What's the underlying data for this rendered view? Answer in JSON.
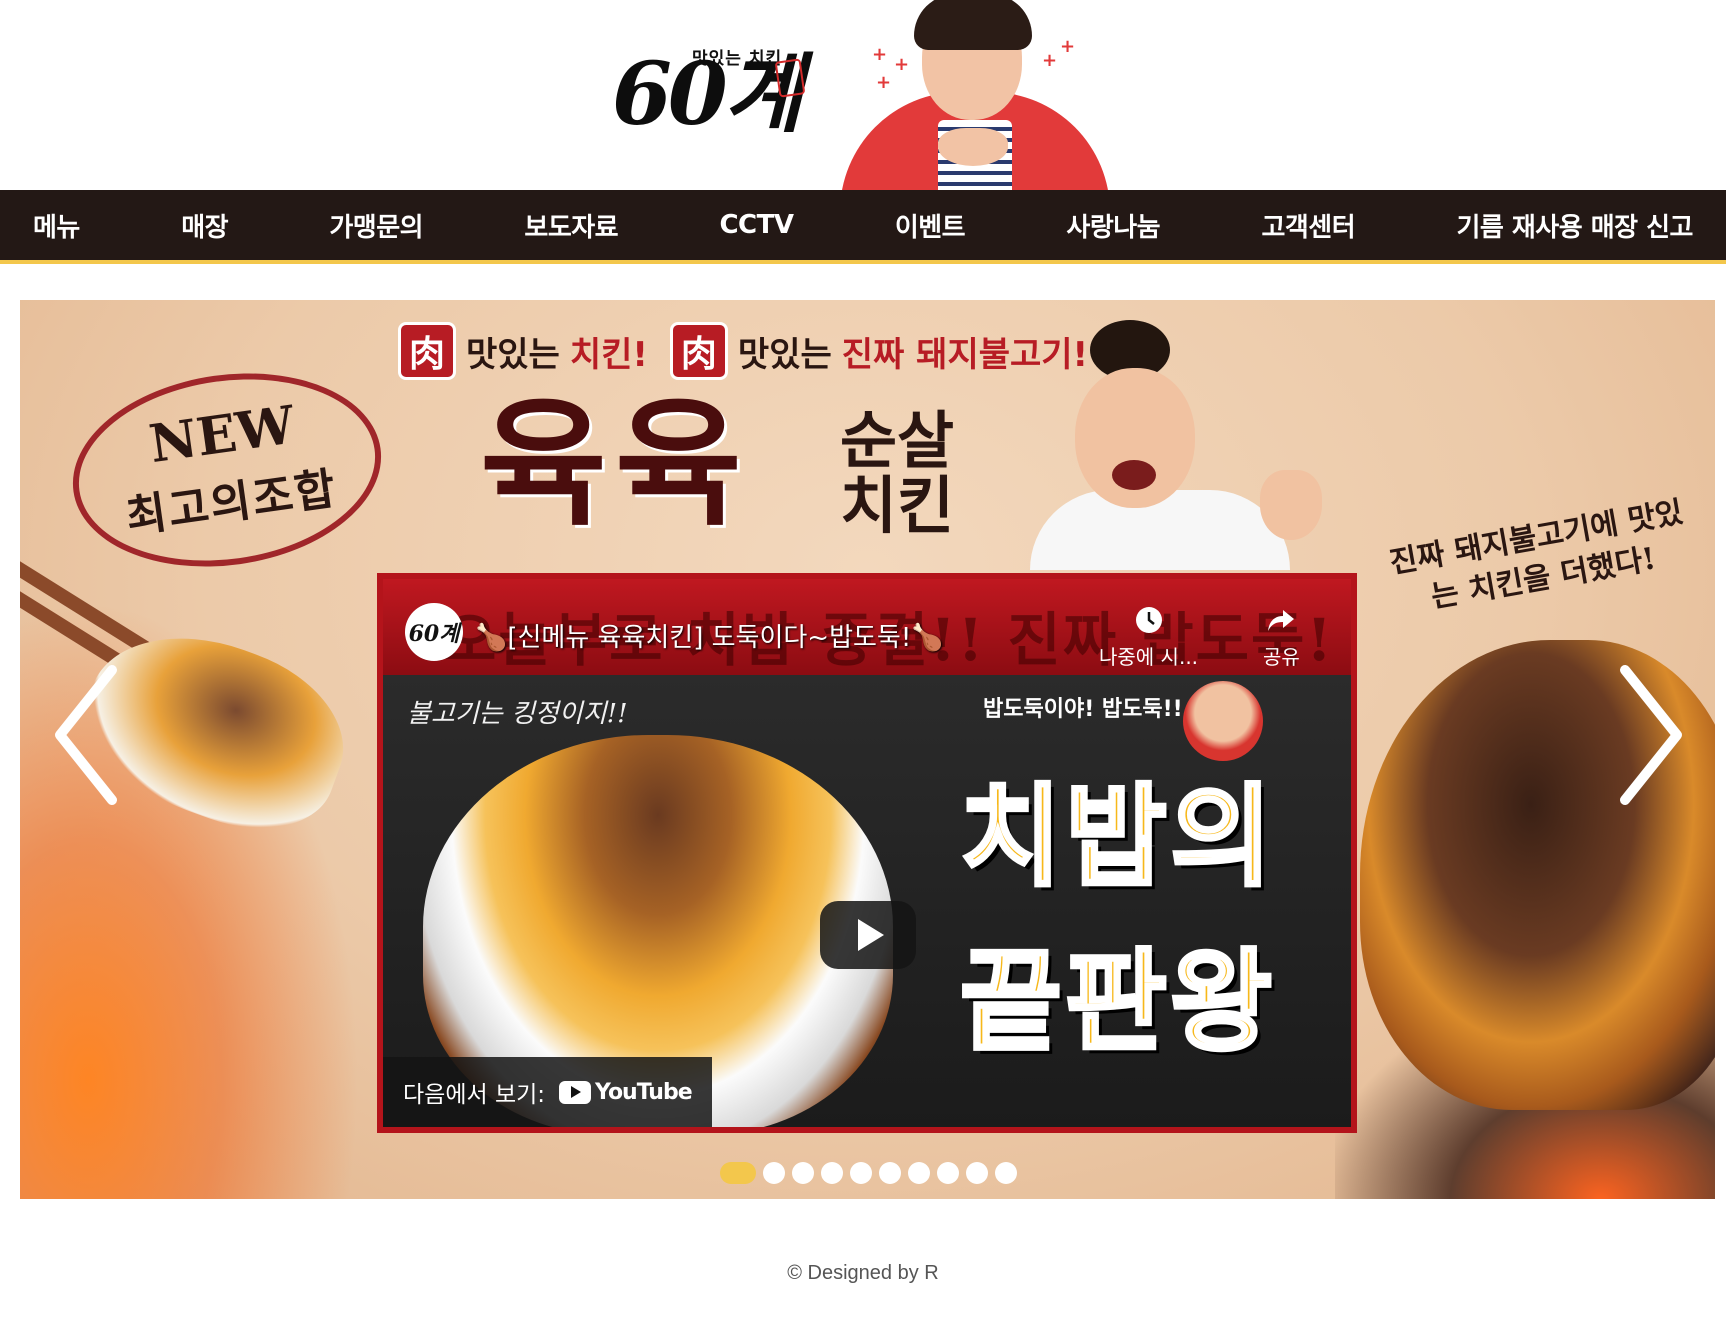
{
  "header": {
    "logo_tagline": "맛있는 치킨",
    "logo_brand": "60계",
    "sparkles": [
      "+",
      "+",
      "+",
      "+",
      "+"
    ]
  },
  "nav": {
    "items": [
      {
        "label": "메뉴"
      },
      {
        "label": "매장"
      },
      {
        "label": "가맹문의"
      },
      {
        "label": "보도자료"
      },
      {
        "label": "CCTV"
      },
      {
        "label": "이벤트"
      },
      {
        "label": "사랑나눔"
      },
      {
        "label": "고객센터"
      },
      {
        "label": "기름 재사용 매장 신고"
      }
    ]
  },
  "banner": {
    "badge_glyph": "肉",
    "headline_1_prefix": "맛있는",
    "headline_1_accent": "치킨!",
    "headline_2_prefix": "맛있는",
    "headline_2_accent": "진짜 돼지불고기!",
    "big_title": "육육",
    "sub_title": "순살 치킨",
    "stamp_new": "NEW",
    "stamp_combo": "최고의조합",
    "right_caption": "진짜 돼지불고기에 맛있는 치킨을 더했다!"
  },
  "video": {
    "channel_avatar_text": "60계",
    "title": "🍗[신메뉴 육육치킨] 도둑이다~밥도둑!🍗",
    "background_text": "오늘부로 치밥 종결!! 진짜 밥도둑!",
    "watch_later_label": "나중에 시...",
    "share_label": "공유",
    "thumb_handwrite": "불고기는 킹정이지!!",
    "thumb_person_label": "밥도둑이야! 밥도둑!!",
    "thumb_big_text": "치밥의 끝판왕",
    "watch_on_label": "다음에서 보기:",
    "youtube_label": "YouTube"
  },
  "slider": {
    "dot_count": 10,
    "active_index": 0
  },
  "footer": {
    "text": "© Designed by R"
  },
  "colors": {
    "nav_bg": "#231815",
    "nav_border": "#f3c74c",
    "brand_red": "#b71c24",
    "dot_active": "#f3c74c"
  }
}
